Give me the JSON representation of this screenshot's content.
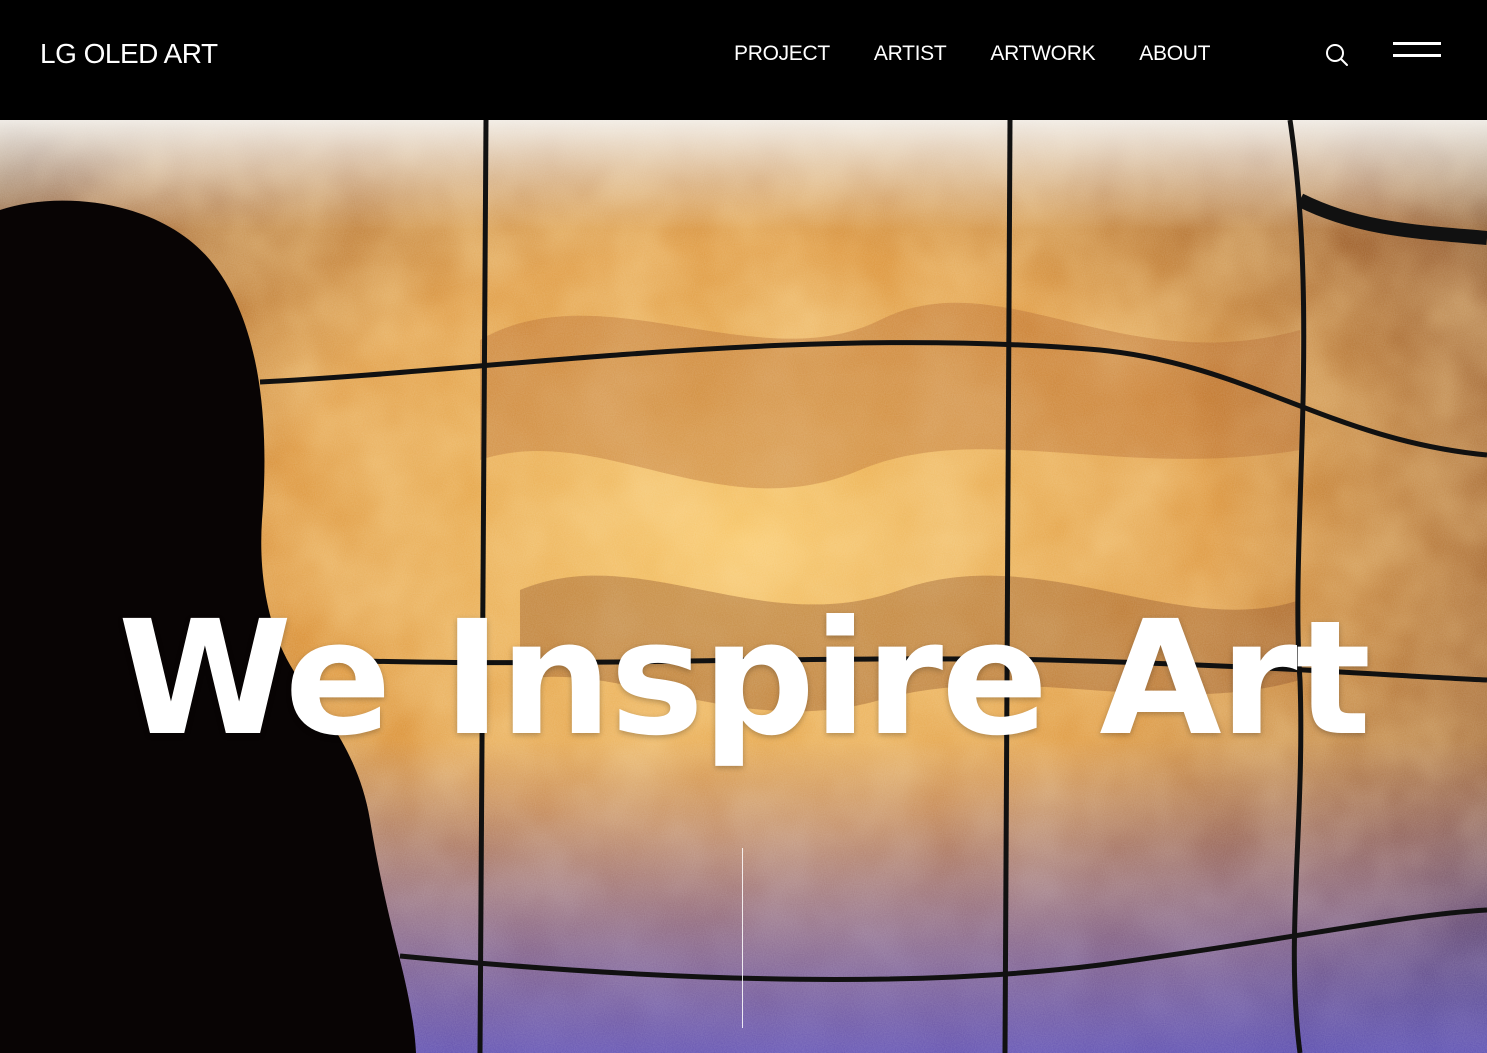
{
  "header": {
    "logo": "LG OLED ART",
    "nav": [
      {
        "label": "PROJECT"
      },
      {
        "label": "ARTIST"
      },
      {
        "label": "ARTWORK"
      },
      {
        "label": "ABOUT"
      }
    ],
    "search_icon": "search-icon",
    "menu_icon": "hamburger-menu-icon"
  },
  "hero": {
    "title": "We Inspire Art"
  },
  "colors": {
    "background": "#000000",
    "text": "#ffffff",
    "art_orange": "#d9902e",
    "art_gold": "#f2c15a",
    "art_violet": "#6a5fd0"
  }
}
